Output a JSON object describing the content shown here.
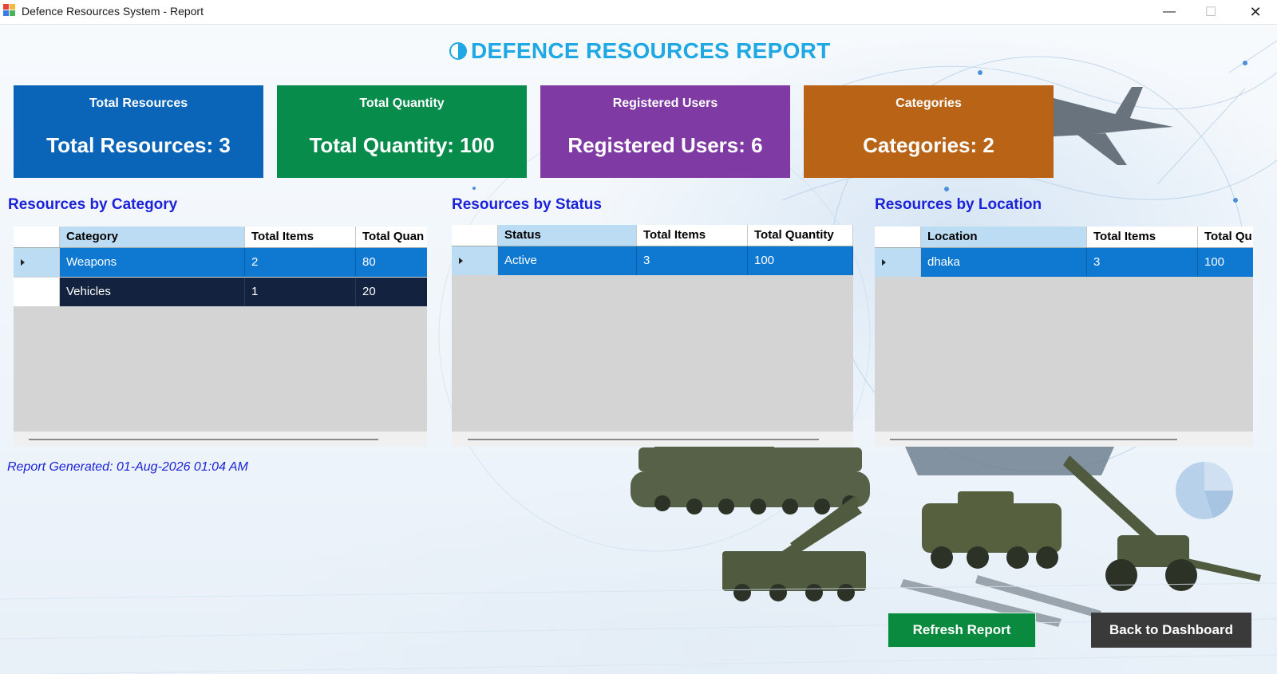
{
  "window": {
    "title": "Defence Resources System - Report",
    "minimize_glyph": "—",
    "maximize_glyph": "☐",
    "close_glyph": "✕"
  },
  "header": {
    "title": "DEFENCE RESOURCES REPORT",
    "icon": "shield-icon"
  },
  "cards": [
    {
      "title": "Total Resources",
      "value": "Total Resources: 3",
      "color": "#0a65b9"
    },
    {
      "title": "Total Quantity",
      "value": "Total Quantity: 100",
      "color": "#088c4c"
    },
    {
      "title": "Registered Users",
      "value": "Registered Users: 6",
      "color": "#7f3aa3"
    },
    {
      "title": "Categories",
      "value": "Categories: 2",
      "color": "#b86316"
    }
  ],
  "sections": {
    "category": {
      "title": "Resources by Category",
      "columns": [
        "Category",
        "Total Items",
        "Total Quan"
      ],
      "rows": [
        [
          "Weapons",
          "2",
          "80"
        ],
        [
          "Vehicles",
          "1",
          "20"
        ]
      ]
    },
    "status": {
      "title": "Resources by Status",
      "columns": [
        "Status",
        "Total Items",
        "Total Quantity"
      ],
      "rows": [
        [
          "Active",
          "3",
          "100"
        ]
      ]
    },
    "location": {
      "title": "Resources by Location",
      "columns": [
        "Location",
        "Total Items",
        "Total Qu"
      ],
      "rows": [
        [
          "dhaka",
          "3",
          "100"
        ]
      ]
    }
  },
  "footer": {
    "generated": "Report Generated: 01-Aug-2026  01:04 AM"
  },
  "buttons": {
    "refresh": "Refresh Report",
    "back": "Back to Dashboard"
  },
  "colors": {
    "accent_title": "#1fa8e4",
    "section_title": "#1b22d8",
    "selected_row": "#0f78d0",
    "dark_row": "#13223f"
  }
}
